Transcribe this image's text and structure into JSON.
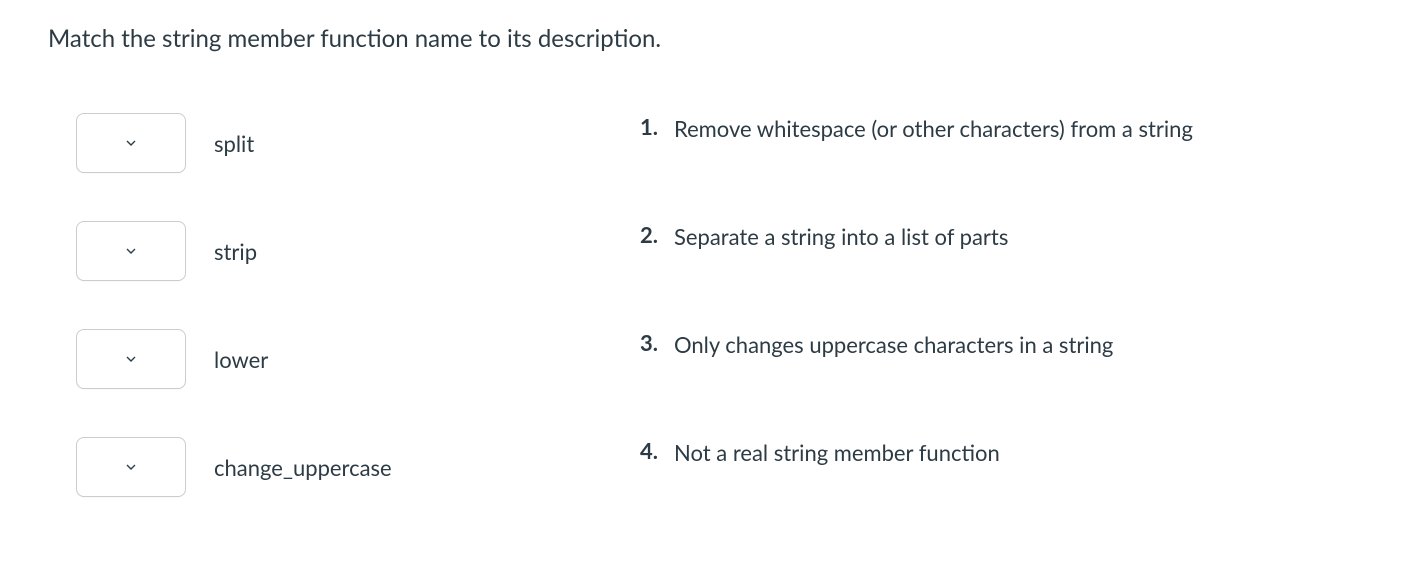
{
  "question": {
    "prompt": "Match the string member function name to its description."
  },
  "items": [
    {
      "label": "split"
    },
    {
      "label": "strip"
    },
    {
      "label": "lower"
    },
    {
      "label": "change_uppercase"
    }
  ],
  "answers": [
    {
      "number": "1.",
      "text": "Remove whitespace (or other characters) from a string"
    },
    {
      "number": "2.",
      "text": "Separate a string into a list of parts"
    },
    {
      "number": "3.",
      "text": "Only changes uppercase characters in a string"
    },
    {
      "number": "4.",
      "text": "Not a real string member function"
    }
  ]
}
